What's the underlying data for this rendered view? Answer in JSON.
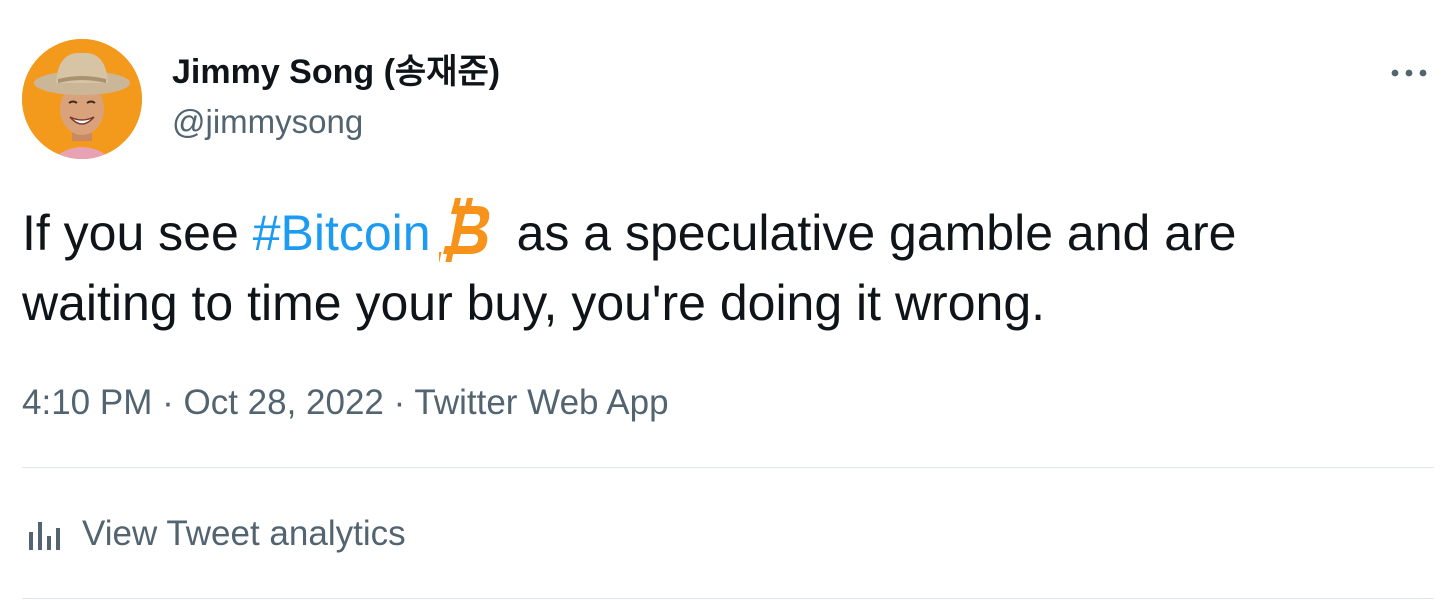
{
  "author": {
    "display_name": "Jimmy Song (송재준)",
    "handle": "@jimmysong",
    "avatar_icon": "user-avatar"
  },
  "tweet": {
    "text_part1": "If you see ",
    "hashtag": "#Bitcoin",
    "emoji_icon": "bitcoin-icon",
    "text_part2": "as a speculative gamble and are",
    "text_line2": "waiting to time your buy, you're doing it wrong."
  },
  "meta": {
    "time": "4:10 PM",
    "separator": " · ",
    "date": "Oct 28, 2022",
    "source": "Twitter Web App"
  },
  "actions": {
    "more_icon": "more-icon",
    "analytics_label": "View Tweet analytics",
    "analytics_icon": "analytics-icon"
  },
  "colors": {
    "link": "#1d9bf0",
    "secondary_text": "#536471",
    "bitcoin_orange": "#f7931a",
    "avatar_bg": "#f39a1c"
  }
}
